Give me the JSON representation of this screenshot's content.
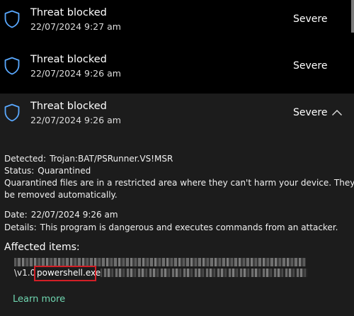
{
  "threats": [
    {
      "title": "Threat blocked",
      "date": "22/07/2024 9:27 am",
      "severity": "Severe"
    },
    {
      "title": "Threat blocked",
      "date": "22/07/2024 9:26 am",
      "severity": "Severe"
    },
    {
      "title": "Threat blocked",
      "date": "22/07/2024 9:26 am",
      "severity": "Severe"
    }
  ],
  "details": {
    "detected_label": "Detected:",
    "detected_value": "Trojan:BAT/PSRunner.VS!MSR",
    "status_label": "Status:",
    "status_value": "Quarantined",
    "note_line1": "Quarantined files are in a restricted area where they can't harm your device. They will",
    "note_line2": "be removed automatically.",
    "date_label": "Date:",
    "date_value": "22/07/2024 9:26 am",
    "details_label": "Details:",
    "details_value": "This program is dangerous and executes commands from an attacker.",
    "affected_heading": "Affected items:",
    "path_prefix": "\\v1.0",
    "file_name": "powershell.exe",
    "learn_more": "Learn more"
  },
  "colors": {
    "background": "#000000",
    "expanded_background": "#1c1c1c",
    "shield": "#5aa9ff",
    "link": "#6fd6b0",
    "highlight": "#d21f26"
  },
  "icons": {
    "threat": "shield-icon",
    "collapse": "chevron-up-icon"
  }
}
